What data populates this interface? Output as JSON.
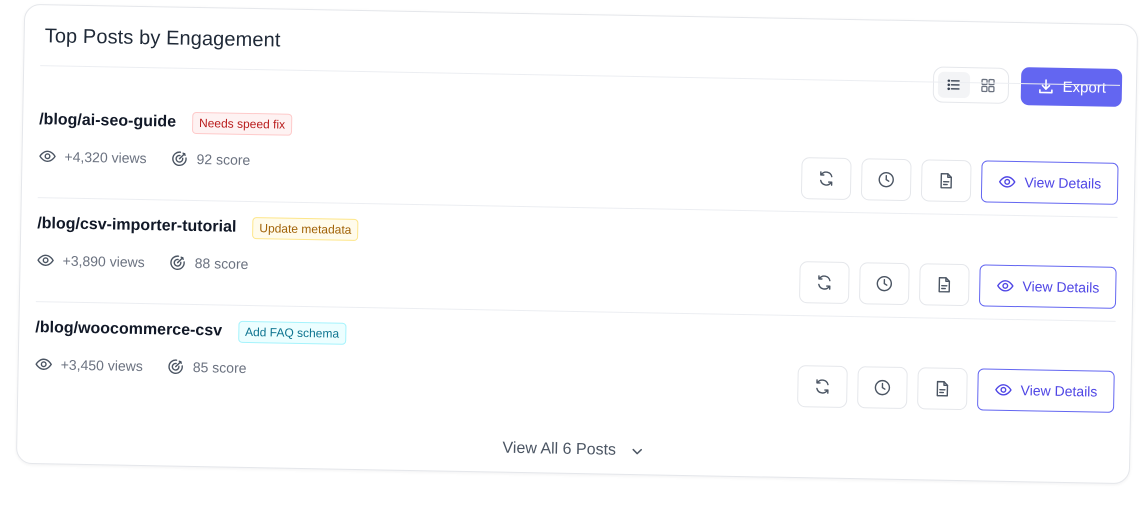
{
  "card": {
    "title": "Top Posts by Engagement",
    "export_label": "Export",
    "view_all_label": "View All 6 Posts"
  },
  "posts": [
    {
      "path": "/blog/ai-seo-guide",
      "badge": "Needs speed fix",
      "badge_bg": "#fef2f2",
      "badge_border": "#fecaca",
      "badge_color": "#b91c1c",
      "views": "+4,320 views",
      "score": "92 score",
      "details_label": "View Details"
    },
    {
      "path": "/blog/csv-importer-tutorial",
      "badge": "Update metadata",
      "badge_bg": "#fffbeb",
      "badge_border": "#fde68a",
      "badge_color": "#a16207",
      "views": "+3,890 views",
      "score": "88 score",
      "details_label": "View Details"
    },
    {
      "path": "/blog/woocommerce-csv",
      "badge": "Add FAQ schema",
      "badge_bg": "#ecfeff",
      "badge_border": "#a5f3fc",
      "badge_color": "#0e7490",
      "views": "+3,450 views",
      "score": "85 score",
      "details_label": "View Details"
    }
  ],
  "icons": {
    "list_view": "list-icon",
    "grid_view": "grid-icon",
    "export": "download-icon",
    "views": "eye-icon",
    "score": "target-icon",
    "refresh": "refresh-icon",
    "history": "clock-icon",
    "report": "document-icon",
    "details": "eye-icon",
    "expand": "chevron-down-icon"
  },
  "colors": {
    "accent": "#6366f1",
    "accent_text": "#4f46e5"
  }
}
